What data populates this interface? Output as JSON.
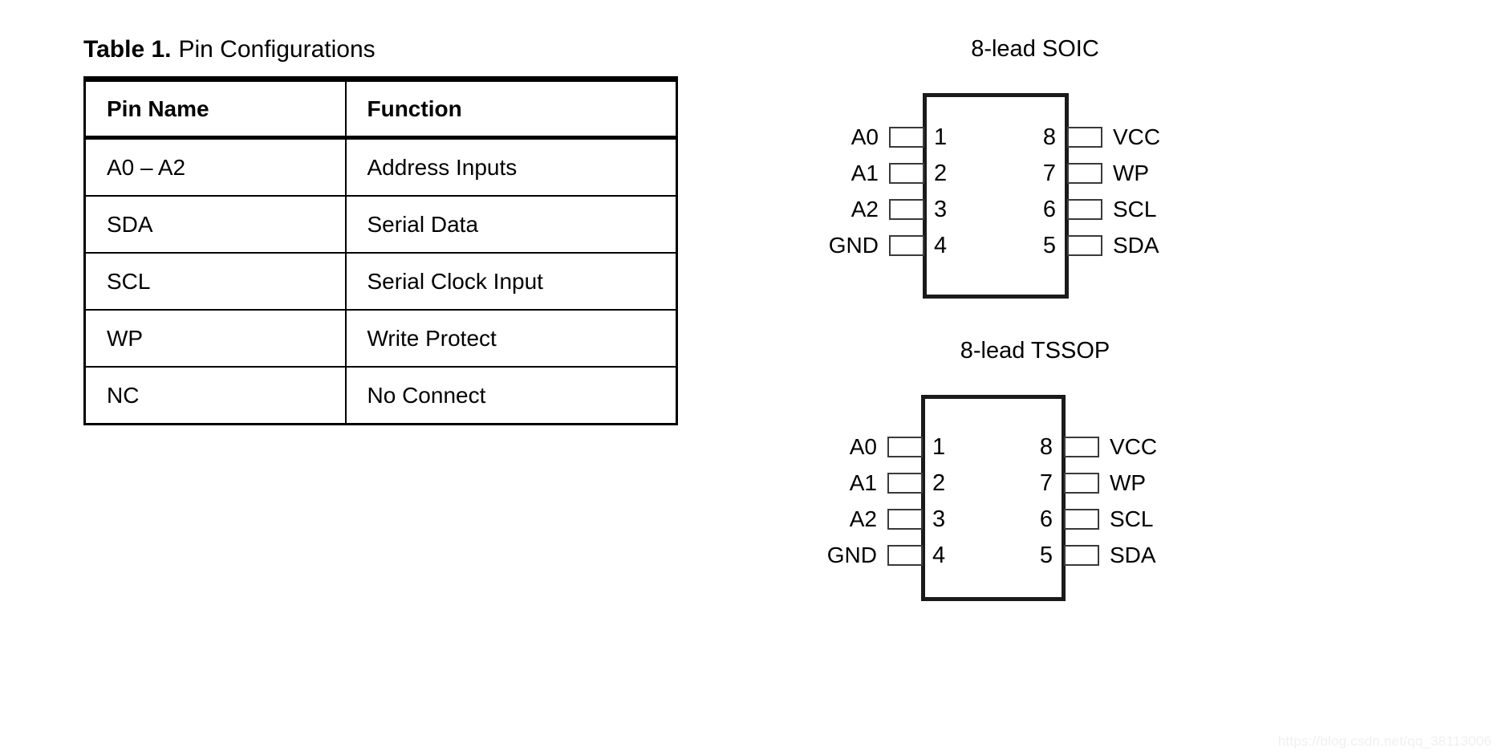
{
  "table": {
    "caption_label": "Table 1.",
    "caption_text": "Pin Configurations",
    "columns": [
      "Pin Name",
      "Function"
    ],
    "rows": [
      {
        "pin_name": "A0 – A2",
        "function": "Address Inputs"
      },
      {
        "pin_name": "SDA",
        "function": "Serial Data"
      },
      {
        "pin_name": "SCL",
        "function": "Serial Clock Input"
      },
      {
        "pin_name": "WP",
        "function": "Write Protect"
      },
      {
        "pin_name": "NC",
        "function": "No Connect"
      }
    ]
  },
  "packages": [
    {
      "title": "8-lead SOIC",
      "left_pins": [
        {
          "num": "1",
          "label": "A0"
        },
        {
          "num": "2",
          "label": "A1"
        },
        {
          "num": "3",
          "label": "A2"
        },
        {
          "num": "4",
          "label": "GND"
        }
      ],
      "right_pins": [
        {
          "num": "8",
          "label": "VCC"
        },
        {
          "num": "7",
          "label": "WP"
        },
        {
          "num": "6",
          "label": "SCL"
        },
        {
          "num": "5",
          "label": "SDA"
        }
      ]
    },
    {
      "title": "8-lead TSSOP",
      "left_pins": [
        {
          "num": "1",
          "label": "A0"
        },
        {
          "num": "2",
          "label": "A1"
        },
        {
          "num": "3",
          "label": "A2"
        },
        {
          "num": "4",
          "label": "GND"
        }
      ],
      "right_pins": [
        {
          "num": "8",
          "label": "VCC"
        },
        {
          "num": "7",
          "label": "WP"
        },
        {
          "num": "6",
          "label": "SCL"
        },
        {
          "num": "5",
          "label": "SDA"
        }
      ]
    }
  ],
  "watermark": "https://blog.csdn.net/qq_38113006",
  "colors": {
    "ink": "#000000",
    "chip_outline": "#1a1a1a",
    "lead_outline": "#3a3a3a",
    "background": "#ffffff",
    "watermark": "#f0f0f0"
  }
}
